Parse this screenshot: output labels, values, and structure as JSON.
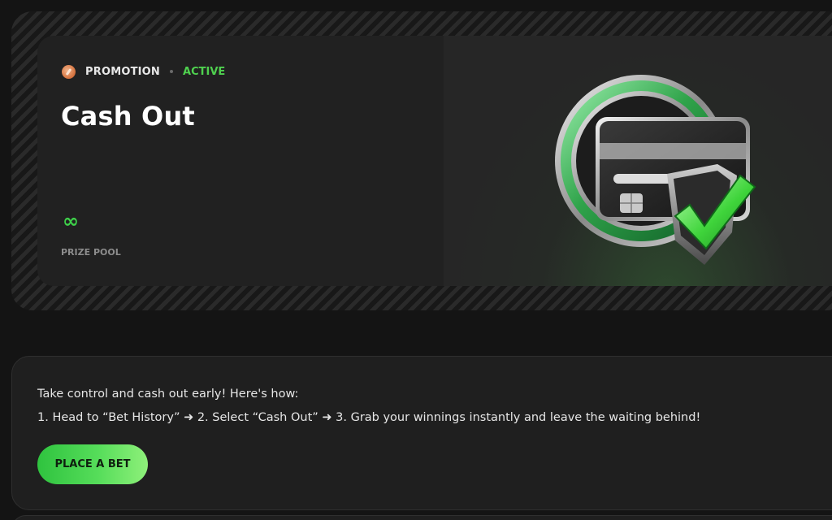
{
  "promotion": {
    "category": "PROMOTION",
    "status": "ACTIVE",
    "title": "Cash Out",
    "prize_pool_value": "∞",
    "prize_pool_label": "PRIZE POOL"
  },
  "description": {
    "line1": "Take control and cash out early! Here's how:",
    "line2": "1. Head to “Bet History” ➜ 2. Select “Cash Out” ➜ 3. Grab your winnings instantly and leave the waiting behind!"
  },
  "cta": {
    "label": "PLACE A BET"
  },
  "colors": {
    "accent_green": "#4fd14f",
    "background": "#141414",
    "card": "#212121"
  },
  "icons": {
    "promotion": "promotion-icon",
    "illustration": "card-shield-check-icon"
  }
}
